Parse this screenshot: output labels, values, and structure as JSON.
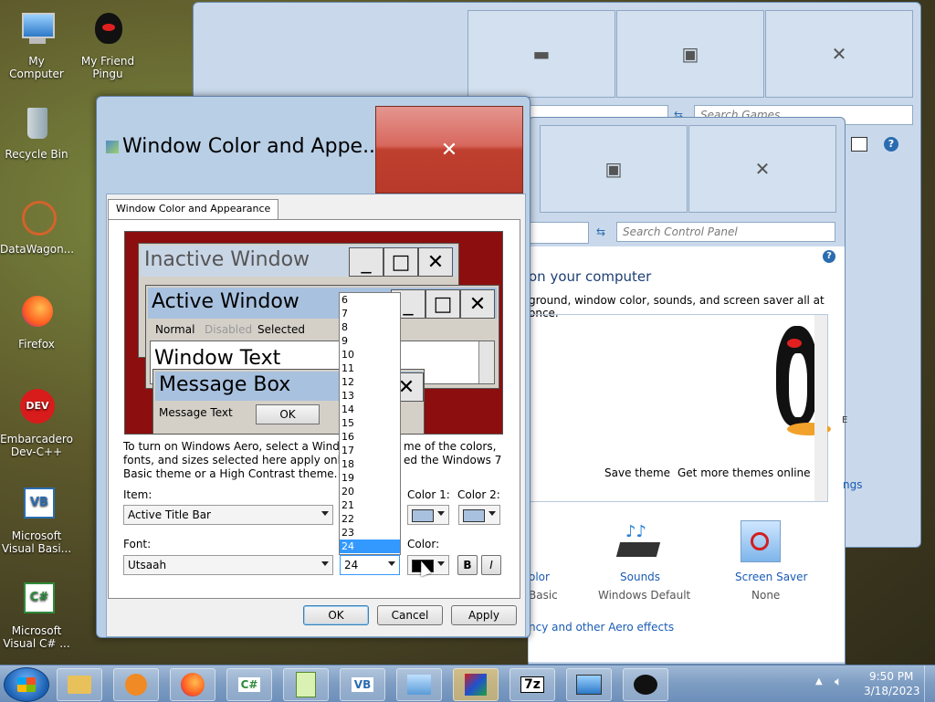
{
  "desktop": {
    "icons": [
      {
        "label": "My Computer"
      },
      {
        "label": "My Friend Pingu"
      },
      {
        "label": "Recycle Bin"
      },
      {
        "label": "DataWagon..."
      },
      {
        "label": "Firefox"
      },
      {
        "label": "Embarcadero Dev-C++"
      },
      {
        "label": "Microsoft Visual Basi..."
      },
      {
        "label": "Microsoft Visual C# ..."
      }
    ]
  },
  "games_window": {
    "search_placeholder": "Search Games"
  },
  "control_panel": {
    "search_placeholder": "Search Control Panel",
    "heading": "on your computer",
    "subtext": "ground, window color, sounds, and screen saver all at once.",
    "save_theme": "Save theme",
    "get_more_themes": "Get more themes online",
    "settings_link": "ngs",
    "side_letter": "E",
    "color_label": "olor",
    "color_value": "Basic",
    "sounds_label": "Sounds",
    "sounds_value": "Windows Default",
    "screensaver_label": "Screen Saver",
    "screensaver_value": "None",
    "aero_link": "ncy and other Aero effects"
  },
  "dialog": {
    "title": "Window Color and Appe...",
    "close_glyph": "✕",
    "tab_label": "Window Color and Appearance",
    "preview": {
      "inactive_title": "Inactive Window",
      "active_title": "Active Window",
      "menu_normal": "Normal",
      "menu_disabled": "Disabled",
      "menu_selected": "Selected",
      "window_text": "Window Text",
      "msgbox_title": "Message Box",
      "msgbox_text": "Message Text",
      "msgbox_ok": "OK"
    },
    "info_line1": "To turn on Windows Aero, select a Windows",
    "info_line1_end": "me of the colors,",
    "info_line2": "fonts, and sizes selected here apply only if yo",
    "info_line2_end": "ed the Windows 7",
    "info_line3": "Basic theme or a High Contrast theme.",
    "item_label": "Item:",
    "item_value": "Active Title Bar",
    "color1_label": "Color 1:",
    "color2_label": "Color 2:",
    "font_label": "Font:",
    "font_value": "Utsaah",
    "size_value": "24",
    "color_label": "Color:",
    "bold_label": "B",
    "italic_label": "I",
    "ok": "OK",
    "cancel": "Cancel",
    "apply": "Apply",
    "size_options": [
      "6",
      "7",
      "8",
      "9",
      "10",
      "11",
      "12",
      "13",
      "14",
      "15",
      "16",
      "17",
      "18",
      "19",
      "20",
      "21",
      "22",
      "23",
      "24"
    ],
    "selected_size": "24"
  },
  "taskbar": {
    "time": "9:50 PM",
    "date": "3/18/2023",
    "items": [
      "explorer",
      "media-player",
      "firefox",
      "visual-csharp",
      "notepad-plus",
      "visual-basic",
      "control-panel",
      "winrar",
      "7zip",
      "remote-desktop",
      "pingu"
    ]
  },
  "colors": {
    "preview_bg": "#8c0e0e",
    "accent": "#1a5bb4",
    "selection": "#3399ff"
  }
}
